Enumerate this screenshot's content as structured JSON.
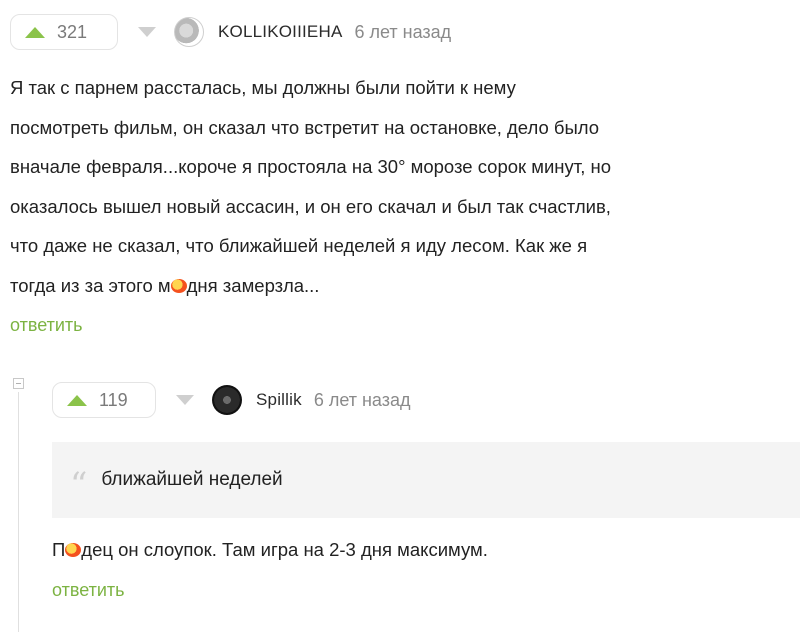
{
  "comments": [
    {
      "rating": "321",
      "username": "KOLLIKOIIIEHA",
      "time": "6 лет назад",
      "text_lines": [
        "Я так с парнем рассталась, мы должны были пойти к нему",
        "посмотреть фильм, он сказал что встретит на остановке, дело было",
        "вначале февраля...короче я простояла на 30° морозе сорок минут, но",
        "оказалось вышел новый ассасин, и он его скачал и был так счастлив,",
        "что даже не сказал, что ближайшей неделей я иду лесом. Как же я"
      ],
      "last_line_before": "тогда из за этого м",
      "last_line_after": "дня замерзла...",
      "reply_label": "ответить"
    },
    {
      "rating": "119",
      "username": "Spillik",
      "time": "6 лет назад",
      "quote": "ближайшей неделей",
      "text_before": "П",
      "text_after": "дец он слоупок. Там игра на 2-3 дня максимум.",
      "reply_label": "ответить"
    }
  ],
  "icons": {
    "upvote": "upvote-triangle-icon",
    "downvote": "downvote-triangle-icon",
    "quote": "quote-marks-icon",
    "censor_emoji": "censor-emoji-icon",
    "collapse": "collapse-thread-icon"
  },
  "colors": {
    "upvote": "#8bc34a",
    "link": "#7cb342",
    "quote_bg": "#f4f4f4"
  }
}
